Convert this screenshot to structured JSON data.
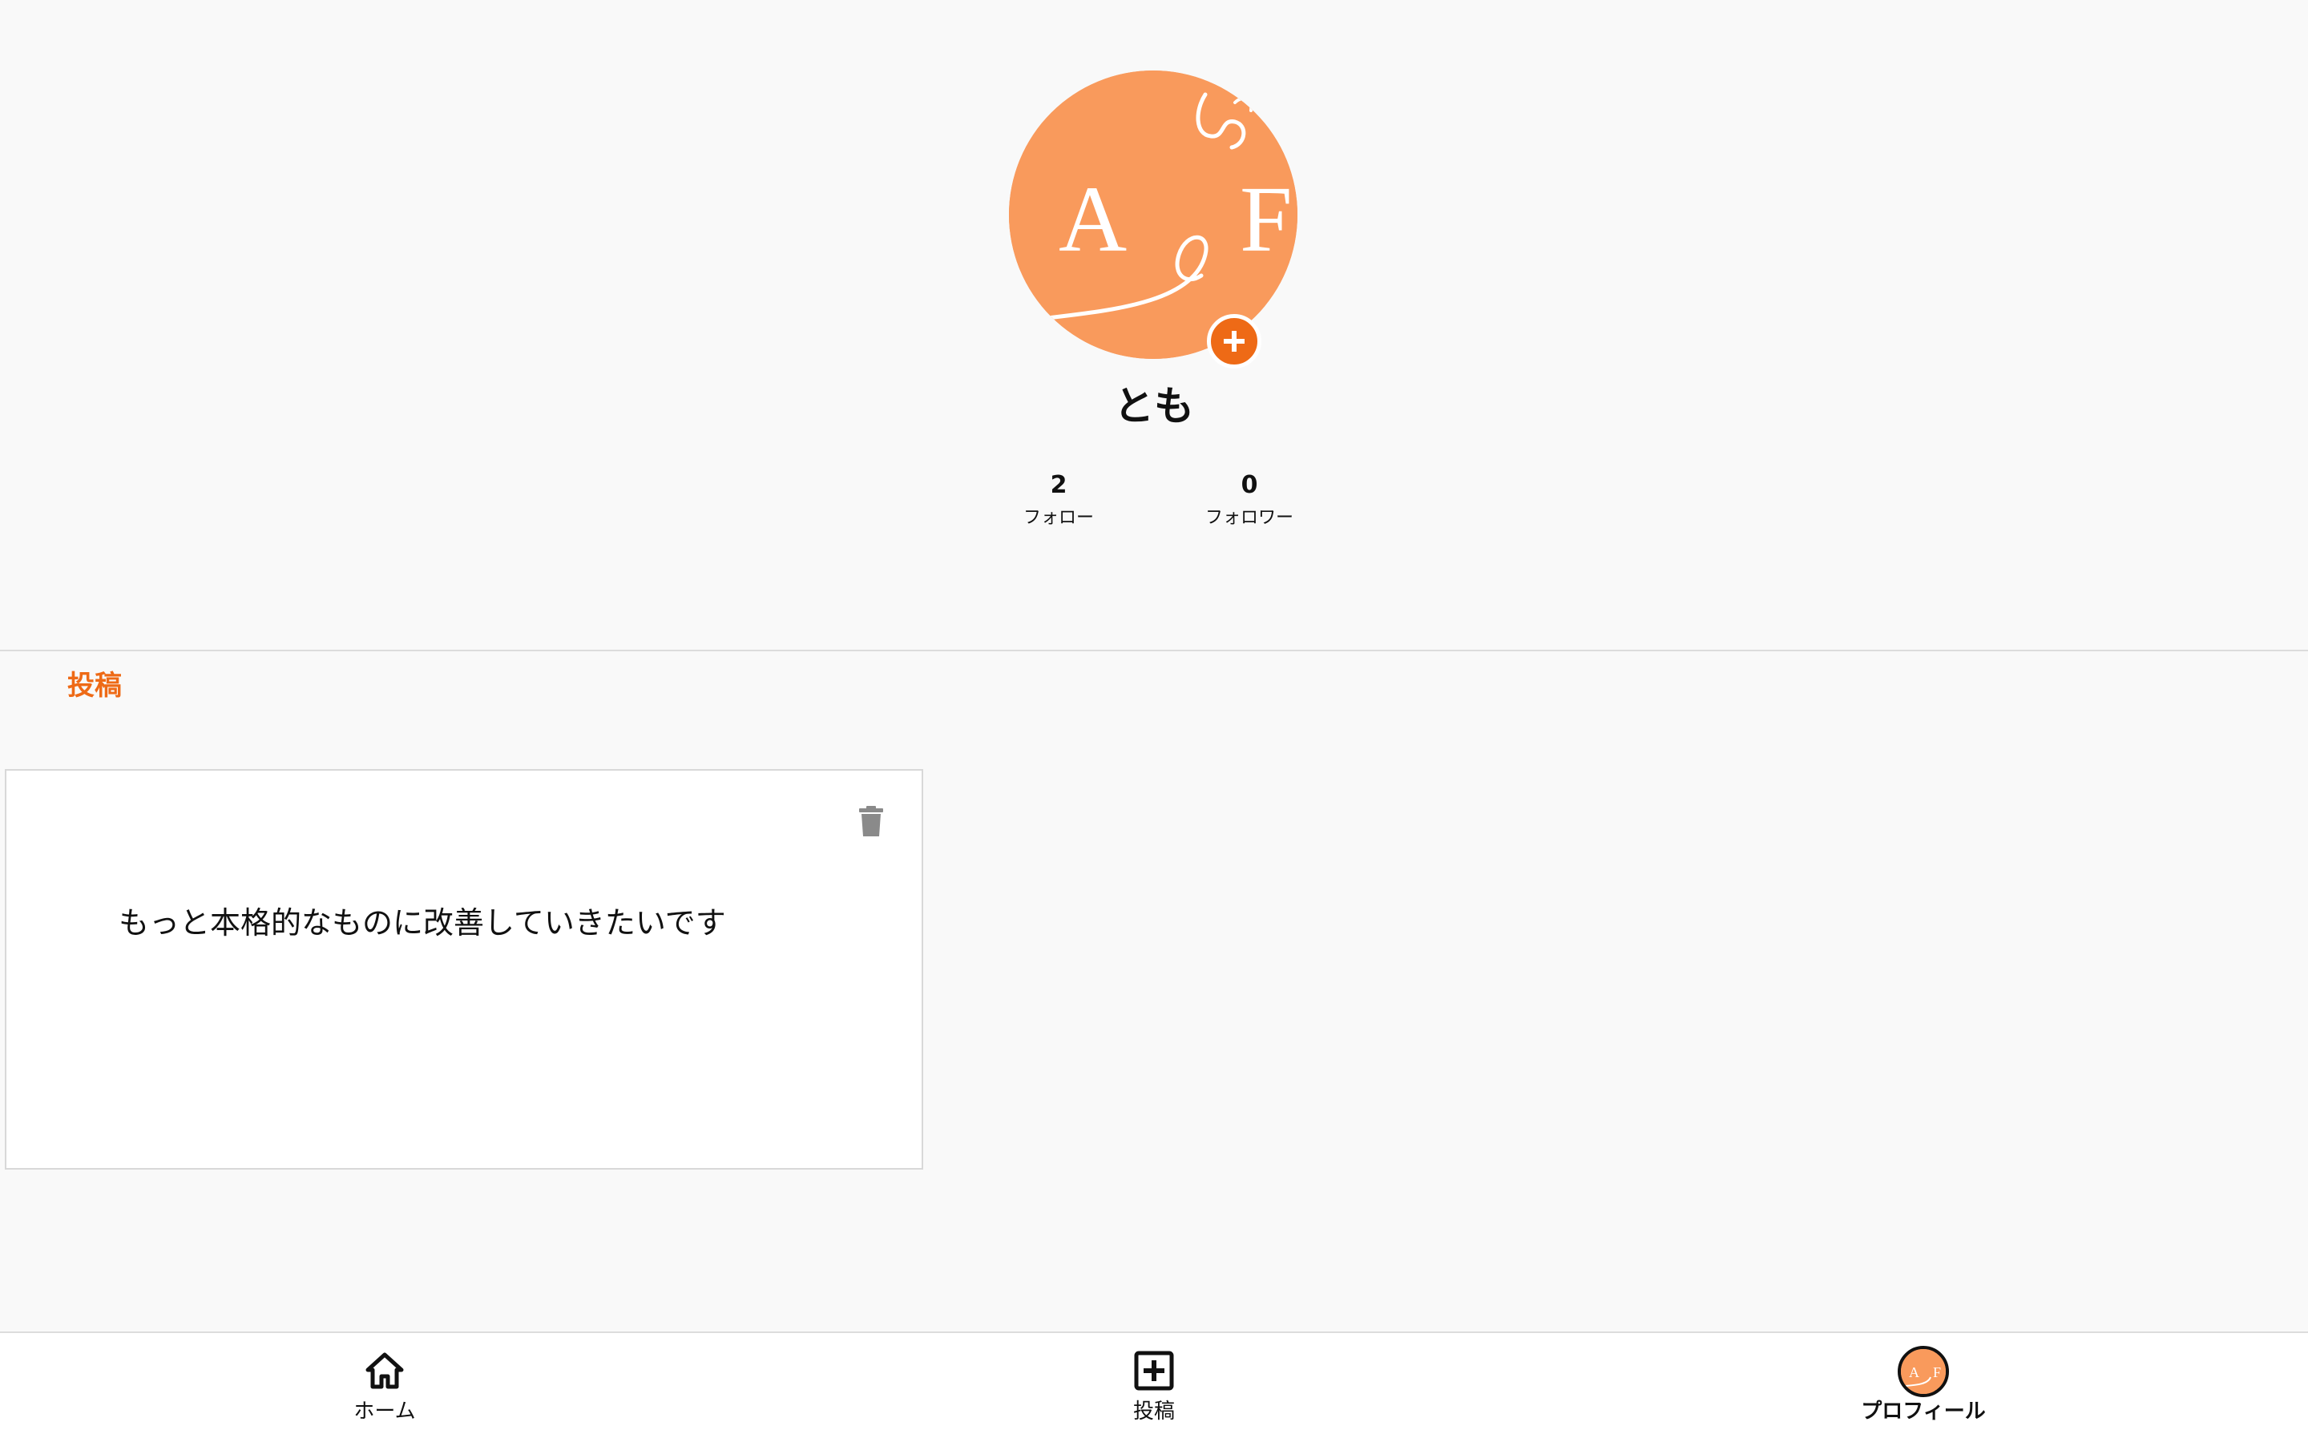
{
  "profile": {
    "avatar_icon": "avatar-image",
    "avatar_text_left": "A",
    "avatar_text_right": "F",
    "avatar_color": "#f99a5c",
    "add_icon": "plus-icon",
    "add_color": "#ee6a16",
    "username": "とも",
    "following": {
      "count": "2",
      "label": "フォロー"
    },
    "followers": {
      "count": "0",
      "label": "フォロワー"
    }
  },
  "posts_section": {
    "tab_label": "投稿",
    "tab_color": "#ee6a16",
    "items": [
      {
        "text": "もっと本格的なものに改善していきたいです",
        "delete_icon": "trash-icon"
      }
    ]
  },
  "bottom_nav": {
    "items": [
      {
        "label": "ホーム",
        "icon": "home-icon",
        "active": false
      },
      {
        "label": "投稿",
        "icon": "add-square-icon",
        "active": false
      },
      {
        "label": "プロフィール",
        "icon": "profile-avatar",
        "active": true
      }
    ]
  }
}
